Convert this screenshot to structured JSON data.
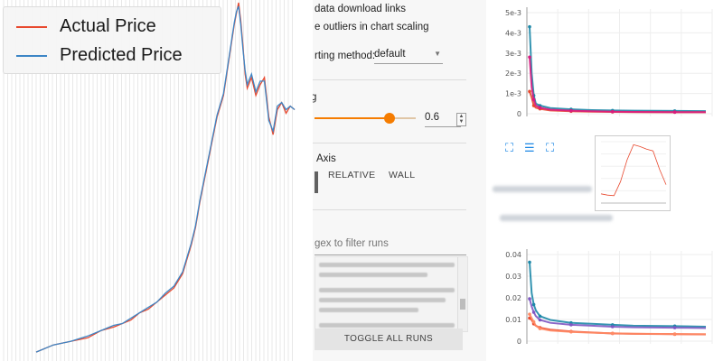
{
  "settings": {
    "download_links_label": "data download links",
    "outliers_label": "e outliers in chart scaling",
    "sorting_label": "rting method:",
    "sorting_value": "default",
    "smoothing_label": "g",
    "smoothing_value": "0.6",
    "smoothing_fraction": 0.6,
    "axis_label": "Axis",
    "axis_options": [
      "RELATIVE",
      "WALL"
    ],
    "filter_placeholder": "gex to filter runs",
    "toggle_runs_label": "TOGGLE ALL RUNS"
  },
  "legend": {
    "actual_label": "Actual Price",
    "predicted_label": "Predicted Price",
    "actual_color": "#e8492f",
    "predicted_color": "#3d86c6"
  },
  "toolbar_icons": [
    "fit-domain-icon",
    "data-table-icon",
    "expand-icon"
  ],
  "chart_data": [
    {
      "type": "line",
      "title": "",
      "series": [
        {
          "name": "Actual Price",
          "color": "#e8492f",
          "x": [
            0,
            8,
            16,
            24,
            30,
            36,
            40,
            44,
            48,
            52,
            56,
            60,
            64,
            68,
            70,
            72,
            74,
            76,
            78,
            80,
            82,
            83,
            84,
            85,
            86,
            87,
            88,
            89,
            90,
            91,
            92,
            93,
            94,
            95,
            96,
            97,
            98,
            100,
            102,
            104,
            106,
            108,
            110,
            112,
            114,
            116,
            118,
            120
          ],
          "y": [
            0.02,
            0.04,
            0.05,
            0.06,
            0.08,
            0.09,
            0.1,
            0.11,
            0.13,
            0.14,
            0.16,
            0.18,
            0.2,
            0.24,
            0.28,
            0.32,
            0.37,
            0.44,
            0.5,
            0.56,
            0.62,
            0.65,
            0.68,
            0.7,
            0.72,
            0.74,
            0.78,
            0.82,
            0.86,
            0.9,
            0.94,
            0.97,
            1.0,
            0.95,
            0.88,
            0.8,
            0.76,
            0.79,
            0.74,
            0.77,
            0.79,
            0.68,
            0.63,
            0.7,
            0.72,
            0.69,
            0.71,
            0.7
          ]
        },
        {
          "name": "Predicted Price",
          "color": "#3d86c6",
          "x": [
            0,
            8,
            16,
            24,
            30,
            36,
            40,
            44,
            48,
            52,
            56,
            60,
            64,
            68,
            70,
            72,
            74,
            76,
            78,
            80,
            82,
            83,
            84,
            85,
            86,
            87,
            88,
            89,
            90,
            91,
            92,
            93,
            94,
            95,
            96,
            97,
            98,
            100,
            102,
            104,
            106,
            108,
            110,
            112,
            114,
            116,
            118,
            120
          ],
          "y": [
            0.02,
            0.04,
            0.05,
            0.065,
            0.08,
            0.095,
            0.1,
            0.115,
            0.13,
            0.145,
            0.16,
            0.185,
            0.205,
            0.245,
            0.285,
            0.325,
            0.375,
            0.445,
            0.505,
            0.565,
            0.625,
            0.655,
            0.685,
            0.705,
            0.725,
            0.745,
            0.785,
            0.825,
            0.865,
            0.905,
            0.945,
            0.975,
            0.99,
            0.94,
            0.87,
            0.81,
            0.77,
            0.8,
            0.75,
            0.78,
            0.78,
            0.67,
            0.64,
            0.71,
            0.72,
            0.7,
            0.71,
            0.7
          ]
        }
      ]
    },
    {
      "type": "line",
      "title": "",
      "yticks": [
        "0",
        "1e-3",
        "2e-3",
        "3e-3",
        "4e-3",
        "5e-3"
      ],
      "ylim": [
        0,
        0.005
      ],
      "series": [
        {
          "color": "#1e88a8",
          "x": [
            0,
            2,
            4,
            6,
            10,
            20,
            40,
            60,
            80,
            100,
            140,
            170
          ],
          "y": [
            0.0043,
            0.002,
            0.0009,
            0.0005,
            0.0004,
            0.00028,
            0.00022,
            0.00018,
            0.00016,
            0.00015,
            0.00014,
            0.00013
          ]
        },
        {
          "color": "#e8492f",
          "x": [
            0,
            2,
            4,
            6,
            10,
            20,
            40,
            60,
            80,
            100,
            140,
            170
          ],
          "y": [
            0.0011,
            0.0008,
            0.0004,
            0.0003,
            0.00024,
            0.00016,
            0.00012,
            0.0001,
            9e-05,
            8e-05,
            7e-05,
            7e-05
          ]
        },
        {
          "color": "#d81b7f",
          "x": [
            0,
            2,
            4,
            6,
            10,
            20,
            40,
            60,
            80,
            100,
            140,
            170
          ],
          "y": [
            0.0028,
            0.0013,
            0.0007,
            0.0004,
            0.0003,
            0.0002,
            0.00015,
            0.00012,
            0.0001,
            9e-05,
            8e-05,
            8e-05
          ]
        }
      ]
    },
    {
      "type": "line",
      "title": "",
      "yticks": [
        "0",
        "0.01",
        "0.02",
        "0.03",
        "0.04"
      ],
      "ylim": [
        0,
        0.045
      ],
      "series": [
        {
          "color": "#1e88a8",
          "x": [
            0,
            2,
            4,
            6,
            10,
            20,
            40,
            60,
            80,
            100,
            140,
            170
          ],
          "y": [
            0.041,
            0.025,
            0.019,
            0.016,
            0.013,
            0.011,
            0.0095,
            0.009,
            0.0085,
            0.008,
            0.0078,
            0.0075
          ]
        },
        {
          "color": "#7e57c2",
          "x": [
            0,
            2,
            4,
            6,
            10,
            20,
            40,
            60,
            80,
            100,
            140,
            170
          ],
          "y": [
            0.022,
            0.018,
            0.015,
            0.013,
            0.011,
            0.0095,
            0.0085,
            0.008,
            0.0075,
            0.0072,
            0.007,
            0.0068
          ]
        },
        {
          "color": "#e8492f",
          "x": [
            0,
            2,
            4,
            6,
            10,
            20,
            40,
            60,
            80,
            100,
            140,
            170
          ],
          "y": [
            0.012,
            0.011,
            0.009,
            0.008,
            0.007,
            0.006,
            0.005,
            0.0045,
            0.004,
            0.0038,
            0.0036,
            0.0035
          ]
        },
        {
          "color": "#ff8a65",
          "x": [
            0,
            2,
            4,
            6,
            10,
            20,
            40,
            60,
            80,
            100,
            140,
            170
          ],
          "y": [
            0.014,
            0.012,
            0.01,
            0.008,
            0.0065,
            0.0055,
            0.0048,
            0.0044,
            0.0041,
            0.0039,
            0.0037,
            0.0036
          ]
        }
      ]
    },
    {
      "type": "line",
      "title": "",
      "series": [
        {
          "color": "#e8492f",
          "x": [
            0,
            1,
            2,
            3,
            4,
            5,
            6,
            7,
            8,
            9,
            10
          ],
          "y": [
            0.15,
            0.13,
            0.12,
            0.35,
            0.7,
            0.95,
            0.92,
            0.88,
            0.85,
            0.55,
            0.3
          ]
        }
      ]
    }
  ]
}
